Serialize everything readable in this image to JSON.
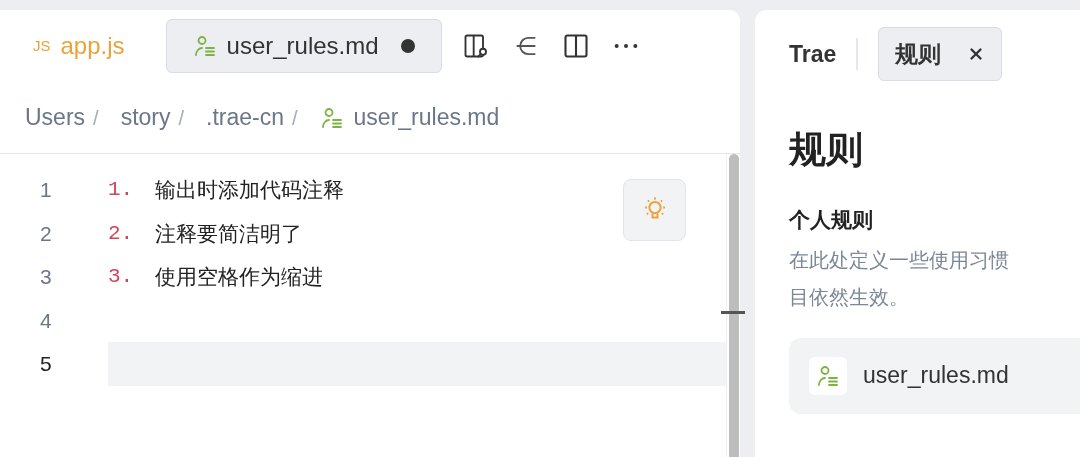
{
  "editor_tabs": [
    {
      "kind": "js",
      "badge": "JS",
      "label": "app.js",
      "selected": false,
      "modified": false
    },
    {
      "kind": "rules",
      "label": "user_rules.md",
      "selected": true,
      "modified": true
    }
  ],
  "breadcrumb": [
    {
      "kind": "folder",
      "label": "Users",
      "separator": "/"
    },
    {
      "kind": "folder",
      "label": "story",
      "separator": "/"
    },
    {
      "kind": "folder",
      "label": ".trae-cn",
      "separator": "/"
    },
    {
      "kind": "rules",
      "label": "user_rules.md"
    }
  ],
  "code_lines": [
    {
      "number": "1",
      "marker": "1.",
      "text": "输出时添加代码注释",
      "current": false
    },
    {
      "number": "2",
      "marker": "2.",
      "text": "注释要简洁明了",
      "current": false
    },
    {
      "number": "3",
      "marker": "3.",
      "text": "使用空格作为缩进",
      "current": false
    },
    {
      "number": "4",
      "current": false
    },
    {
      "number": "5",
      "current": true
    }
  ],
  "panel_tabs": [
    {
      "label": "Trae",
      "selected": false,
      "closable": false
    },
    {
      "label": "规则",
      "selected": true,
      "closable": true
    }
  ],
  "panel": {
    "title": "规则",
    "section_title": "个人规则",
    "description_lines": [
      "在此处定义一些使用习惯",
      "目依然生效。"
    ],
    "file": "user_rules.md"
  }
}
